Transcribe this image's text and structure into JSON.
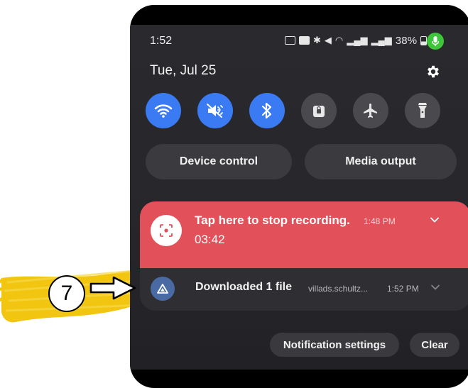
{
  "status_bar": {
    "time": "1:52",
    "battery": "38%",
    "icons": [
      "screen-cast-icon",
      "nfc-icon",
      "bluetooth-icon",
      "mute-icon",
      "wifi-icon",
      "signal-icon",
      "signal-icon",
      "battery-icon",
      "mic-icon"
    ]
  },
  "header": {
    "date": "Tue, Jul 25",
    "settings_icon": "gear-icon"
  },
  "quick_settings": [
    {
      "name": "wifi",
      "icon": "wifi-icon",
      "active": true
    },
    {
      "name": "sound",
      "icon": "mute-icon",
      "active": true
    },
    {
      "name": "bluetooth",
      "icon": "bluetooth-icon",
      "active": true
    },
    {
      "name": "lock",
      "icon": "lock-icon",
      "active": false
    },
    {
      "name": "airplane",
      "icon": "airplane-icon",
      "active": false
    },
    {
      "name": "flashlight",
      "icon": "flashlight-icon",
      "active": false
    }
  ],
  "controls": {
    "device_control": "Device control",
    "media_output": "Media output"
  },
  "notifications": {
    "recording": {
      "title": "Tap here to stop recording.",
      "time": "1:48 PM",
      "duration": "03:42",
      "color": "#e2505a"
    },
    "download": {
      "title": "Downloaded 1 file",
      "subtitle": "villads.schultz...",
      "time": "1:52 PM"
    }
  },
  "actions": {
    "notification_settings": "Notification settings",
    "clear": "Clear"
  },
  "annotation": {
    "number": "7",
    "highlight_color": "#f2c511"
  }
}
